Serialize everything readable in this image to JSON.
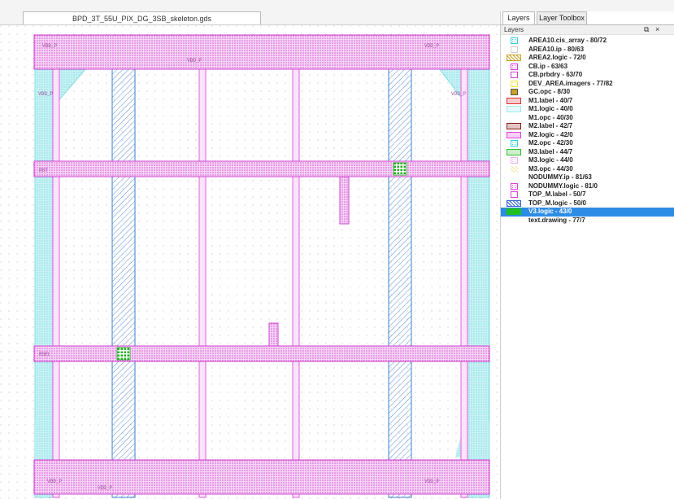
{
  "document": {
    "tab_title": "BPD_3T_55U_PIX_DG_3SB_skeleton.gds"
  },
  "panel": {
    "tabs": [
      {
        "label": "Layers",
        "active": true
      },
      {
        "label": "Layer Toolbox",
        "active": false
      }
    ],
    "title": "Layers",
    "controls": {
      "float": "⧉",
      "close": "×"
    },
    "selection_color": "#2d8de5",
    "layers": [
      {
        "name": "AREA10.cis_array - 80/72",
        "icon": "pattern-swatch-icon",
        "color": "#33c9d9",
        "style": "dots",
        "selected": false
      },
      {
        "name": "AREA10.ip - 80/63",
        "icon": "outline-swatch-icon",
        "color": "#d0d0d0",
        "style": "outline",
        "selected": false
      },
      {
        "name": "AREA2.logic - 72/0",
        "icon": "hatch-swatch-icon",
        "color": "#c9a227",
        "style": "hatch",
        "selected": false
      },
      {
        "name": "CB.ip - 63/63",
        "icon": "pattern-swatch-icon",
        "color": "#e040e0",
        "style": "dots",
        "selected": false
      },
      {
        "name": "CB.prbdry - 63/70",
        "icon": "pattern-swatch-icon",
        "color": "#d040d0",
        "style": "outline",
        "selected": false
      },
      {
        "name": "DEV_AREA.imagers - 77/82",
        "icon": "pattern-swatch-icon",
        "color": "#f2e04a",
        "style": "dots",
        "selected": false
      },
      {
        "name": "GC.opc - 8/30",
        "icon": "outline-swatch-icon",
        "color": "#c9a227",
        "style": "solidbox",
        "selected": false
      },
      {
        "name": "M1.label - 40/7",
        "icon": "pattern-swatch-icon",
        "color": "#e03030",
        "style": "dense",
        "selected": false
      },
      {
        "name": "M1.logic - 40/0",
        "icon": "pattern-swatch-icon",
        "color": "#9ee8ee",
        "style": "dense",
        "selected": false
      },
      {
        "name": "M1.opc - 40/30",
        "icon": "none",
        "color": "#ffffff",
        "style": "none",
        "selected": false
      },
      {
        "name": "M2.label - 42/7",
        "icon": "pattern-swatch-icon",
        "color": "#8b1a1a",
        "style": "dense",
        "selected": false
      },
      {
        "name": "M2.logic - 42/0",
        "icon": "pattern-swatch-icon",
        "color": "#e040e0",
        "style": "dense",
        "selected": false
      },
      {
        "name": "M2.opc - 42/30",
        "icon": "pattern-swatch-icon",
        "color": "#33d0f0",
        "style": "dots",
        "selected": false
      },
      {
        "name": "M3.label - 44/7",
        "icon": "pattern-swatch-icon",
        "color": "#30c030",
        "style": "dense",
        "selected": false
      },
      {
        "name": "M3.logic - 44/0",
        "icon": "pattern-swatch-icon",
        "color": "#f0b0f0",
        "style": "dots",
        "selected": false
      },
      {
        "name": "M3.opc - 44/30",
        "icon": "hatch-swatch-icon",
        "color": "#f2e0a0",
        "style": "faint",
        "selected": false
      },
      {
        "name": "NODUMMY.ip - 81/63",
        "icon": "none",
        "color": "#ffffff",
        "style": "none",
        "selected": false
      },
      {
        "name": "NODUMMY.logic - 81/0",
        "icon": "pattern-swatch-icon",
        "color": "#e040e0",
        "style": "dots",
        "selected": false
      },
      {
        "name": "TOP_M.label - 50/7",
        "icon": "pattern-swatch-icon",
        "color": "#e040e0",
        "style": "outline",
        "selected": false
      },
      {
        "name": "TOP_M.logic - 50/0",
        "icon": "hatch-swatch-icon",
        "color": "#3060d0",
        "style": "hatch",
        "selected": false
      },
      {
        "name": "V3.logic - 43/0",
        "icon": "solid-swatch-icon",
        "color": "#20c020",
        "style": "solid",
        "selected": true
      },
      {
        "name": "text.drawing - 77/7",
        "icon": "none",
        "color": "#ffffff",
        "style": "none",
        "selected": false
      }
    ]
  },
  "layout_view": {
    "colors": {
      "metal_magenta": "#e040e0",
      "metal_fill": "#f3c2f3",
      "top_metal": "#3a7fd0",
      "cyan_region": "#9ee8ee",
      "via_green": "#30c030"
    },
    "labels": [
      "VDD_P",
      "VDD_P",
      "VDD_P",
      "RST",
      "VDD_P",
      "RSEL",
      "VDD_P",
      "VDD_P",
      "VDD_P",
      "VDD_P"
    ]
  }
}
